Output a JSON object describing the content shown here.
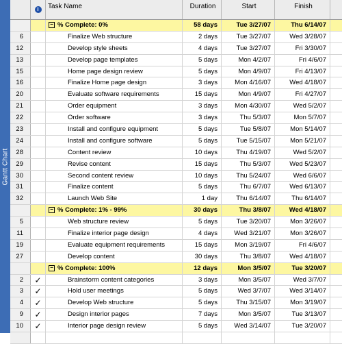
{
  "sidebar": {
    "label": "Gantt Chart"
  },
  "header": {
    "indicator_symbol": "i",
    "task_name": "Task Name",
    "duration": "Duration",
    "start": "Start",
    "finish": "Finish"
  },
  "groups": [
    {
      "title": "% Complete: 0%",
      "toggle": "−",
      "duration": "58 days",
      "start": "Tue 3/27/07",
      "finish": "Thu 6/14/07",
      "tasks": [
        {
          "id": "6",
          "name": "Finalize Web structure",
          "duration": "2 days",
          "start": "Tue 3/27/07",
          "finish": "Wed 3/28/07",
          "done": false
        },
        {
          "id": "12",
          "name": "Develop style sheets",
          "duration": "4 days",
          "start": "Tue 3/27/07",
          "finish": "Fri 3/30/07",
          "done": false
        },
        {
          "id": "13",
          "name": "Develop page templates",
          "duration": "5 days",
          "start": "Mon 4/2/07",
          "finish": "Fri 4/6/07",
          "done": false
        },
        {
          "id": "15",
          "name": "Home page design review",
          "duration": "5 days",
          "start": "Mon 4/9/07",
          "finish": "Fri 4/13/07",
          "done": false
        },
        {
          "id": "16",
          "name": "Finalize Home page design",
          "duration": "3 days",
          "start": "Mon 4/16/07",
          "finish": "Wed 4/18/07",
          "done": false
        },
        {
          "id": "20",
          "name": "Evaluate software requirements",
          "duration": "15 days",
          "start": "Mon 4/9/07",
          "finish": "Fri 4/27/07",
          "done": false
        },
        {
          "id": "21",
          "name": "Order equipment",
          "duration": "3 days",
          "start": "Mon 4/30/07",
          "finish": "Wed 5/2/07",
          "done": false
        },
        {
          "id": "22",
          "name": "Order software",
          "duration": "3 days",
          "start": "Thu 5/3/07",
          "finish": "Mon 5/7/07",
          "done": false
        },
        {
          "id": "23",
          "name": "Install and configure equipment",
          "duration": "5 days",
          "start": "Tue 5/8/07",
          "finish": "Mon 5/14/07",
          "done": false
        },
        {
          "id": "24",
          "name": "Install and configure software",
          "duration": "5 days",
          "start": "Tue 5/15/07",
          "finish": "Mon 5/21/07",
          "done": false
        },
        {
          "id": "28",
          "name": "Content review",
          "duration": "10 days",
          "start": "Thu 4/19/07",
          "finish": "Wed 5/2/07",
          "done": false
        },
        {
          "id": "29",
          "name": "Revise content",
          "duration": "15 days",
          "start": "Thu 5/3/07",
          "finish": "Wed 5/23/07",
          "done": false
        },
        {
          "id": "30",
          "name": "Second content review",
          "duration": "10 days",
          "start": "Thu 5/24/07",
          "finish": "Wed 6/6/07",
          "done": false
        },
        {
          "id": "31",
          "name": "Finalize content",
          "duration": "5 days",
          "start": "Thu 6/7/07",
          "finish": "Wed 6/13/07",
          "done": false
        },
        {
          "id": "32",
          "name": "Launch Web Site",
          "duration": "1 day",
          "start": "Thu 6/14/07",
          "finish": "Thu 6/14/07",
          "done": false
        }
      ]
    },
    {
      "title": "% Complete: 1% - 99%",
      "toggle": "−",
      "duration": "30 days",
      "start": "Thu 3/8/07",
      "finish": "Wed 4/18/07",
      "tasks": [
        {
          "id": "5",
          "name": "Web structure review",
          "duration": "5 days",
          "start": "Tue 3/20/07",
          "finish": "Mon 3/26/07",
          "done": false
        },
        {
          "id": "11",
          "name": "Finalize interior page design",
          "duration": "4 days",
          "start": "Wed 3/21/07",
          "finish": "Mon 3/26/07",
          "done": false
        },
        {
          "id": "19",
          "name": "Evaluate equipment requirements",
          "duration": "15 days",
          "start": "Mon 3/19/07",
          "finish": "Fri 4/6/07",
          "done": false
        },
        {
          "id": "27",
          "name": "Develop content",
          "duration": "30 days",
          "start": "Thu 3/8/07",
          "finish": "Wed 4/18/07",
          "done": false
        }
      ]
    },
    {
      "title": "% Complete: 100%",
      "toggle": "−",
      "duration": "12 days",
      "start": "Mon 3/5/07",
      "finish": "Tue 3/20/07",
      "tasks": [
        {
          "id": "2",
          "name": "Brainstorm content categories",
          "duration": "3 days",
          "start": "Mon 3/5/07",
          "finish": "Wed 3/7/07",
          "done": true
        },
        {
          "id": "3",
          "name": "Hold user meetings",
          "duration": "5 days",
          "start": "Wed 3/7/07",
          "finish": "Wed 3/14/07",
          "done": true
        },
        {
          "id": "4",
          "name": "Develop Web structure",
          "duration": "5 days",
          "start": "Thu 3/15/07",
          "finish": "Mon 3/19/07",
          "done": true
        },
        {
          "id": "9",
          "name": "Design interior pages",
          "duration": "7 days",
          "start": "Mon 3/5/07",
          "finish": "Tue 3/13/07",
          "done": true
        },
        {
          "id": "10",
          "name": "Interior page design review",
          "duration": "5 days",
          "start": "Wed 3/14/07",
          "finish": "Tue 3/20/07",
          "done": true
        }
      ]
    }
  ],
  "colors": {
    "sidebar": "#3d6db5",
    "group_band": "#fdf7a1",
    "header": "#ececec"
  },
  "icons": {
    "done": "checkmark-icon",
    "indicator": "info-icon"
  },
  "check_glyph": "✓"
}
